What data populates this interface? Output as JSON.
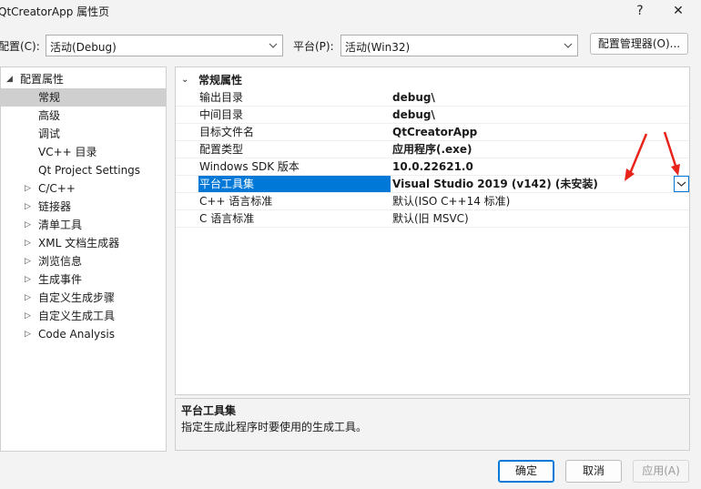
{
  "window": {
    "title": "QtCreatorApp 属性页",
    "help_glyph": "?",
    "close_glyph": "✕"
  },
  "topbar": {
    "config_label": "配置(C):",
    "config_value": "活动(Debug)",
    "platform_label": "平台(P):",
    "platform_value": "活动(Win32)",
    "config_manager_label": "配置管理器(O)..."
  },
  "tree": {
    "root": "配置属性",
    "items": [
      {
        "label": "常规",
        "expandable": false,
        "selected": true
      },
      {
        "label": "高级",
        "expandable": false
      },
      {
        "label": "调试",
        "expandable": false
      },
      {
        "label": "VC++ 目录",
        "expandable": false
      },
      {
        "label": "Qt Project Settings",
        "expandable": false
      },
      {
        "label": "C/C++",
        "expandable": true
      },
      {
        "label": "链接器",
        "expandable": true
      },
      {
        "label": "清单工具",
        "expandable": true
      },
      {
        "label": "XML 文档生成器",
        "expandable": true
      },
      {
        "label": "浏览信息",
        "expandable": true
      },
      {
        "label": "生成事件",
        "expandable": true
      },
      {
        "label": "自定义生成步骤",
        "expandable": true
      },
      {
        "label": "自定义生成工具",
        "expandable": true
      },
      {
        "label": "Code Analysis",
        "expandable": true
      }
    ]
  },
  "grid": {
    "section": "常规属性",
    "rows": [
      {
        "name": "输出目录",
        "value": "debug\\",
        "bold": true
      },
      {
        "name": "中间目录",
        "value": "debug\\",
        "bold": true
      },
      {
        "name": "目标文件名",
        "value": "QtCreatorApp",
        "bold": true
      },
      {
        "name": "配置类型",
        "value": "应用程序(.exe)",
        "bold": true
      },
      {
        "name": "Windows SDK 版本",
        "value": "10.0.22621.0",
        "bold": true
      },
      {
        "name": "平台工具集",
        "value": "Visual Studio 2019 (v142) (未安装)",
        "bold": true,
        "selected": true
      },
      {
        "name": "C++ 语言标准",
        "value": "默认(ISO C++14 标准)",
        "bold": false
      },
      {
        "name": "C 语言标准",
        "value": "默认(旧 MSVC)",
        "bold": false
      }
    ]
  },
  "description": {
    "title": "平台工具集",
    "text": "指定生成此程序时要使用的生成工具。"
  },
  "buttons": {
    "ok": "确定",
    "cancel": "取消",
    "apply": "应用(A)"
  },
  "colors": {
    "accent": "#0078d7",
    "annotation_arrow": "#e8231a"
  }
}
